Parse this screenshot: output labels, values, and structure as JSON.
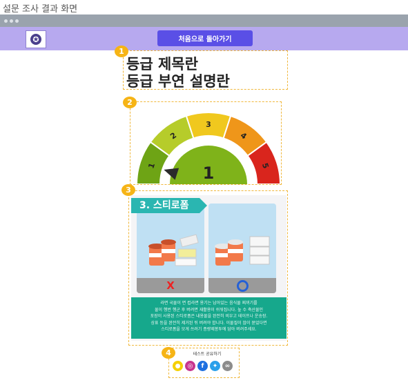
{
  "page": {
    "title": "설문 조사 결과 화면"
  },
  "header": {
    "home_button": "처음으로 돌아가기"
  },
  "sections": {
    "s1": "1",
    "s2": "2",
    "s3": "3",
    "s4": "4"
  },
  "grade": {
    "title": "등급 제목란",
    "description": "등급 부연 설명란"
  },
  "gauge": {
    "value": 1,
    "value_label": "1",
    "segment_labels": [
      "1",
      "2",
      "3",
      "4",
      "5"
    ],
    "segment_colors": [
      "#6ea415",
      "#b6cc2a",
      "#f0c81e",
      "#ef961a",
      "#d9251d"
    ],
    "center_color": "#7fb31a"
  },
  "info": {
    "heading": "3. 스티로폼",
    "wrong_mark": "X",
    "right_mark": "O",
    "text_lines": [
      "라면 국물이 면 컵라면 용기는 남아있는 음식물 찌꺼기를",
      "물이 헹번 헹군 후 버려면 재활용이 쉬워집니다. 높 수 축산물인",
      "포장이 사용된 스티로폼은 내용물을 완전히 비우고 테이프나 운송장.",
      "상표 등을 완전히 제거된 뒤 버려야 합니다. 이물질이 많이 묻었다면",
      "스티로폼을 모게 쓰려기 종량제봉투에 담아 버려주세요."
    ]
  },
  "share": {
    "label": "테스트 공유하기",
    "buttons": [
      {
        "name": "kakao",
        "icon": "kakao-icon",
        "color": "#f5d000"
      },
      {
        "name": "instagram",
        "icon": "instagram-icon",
        "color": "#c7358f"
      },
      {
        "name": "facebook",
        "icon": "facebook-icon",
        "color": "#1d6fe0"
      },
      {
        "name": "twitter",
        "icon": "twitter-icon",
        "color": "#2aa0ea"
      },
      {
        "name": "link",
        "icon": "link-icon",
        "color": "#8c8c8c"
      }
    ]
  }
}
